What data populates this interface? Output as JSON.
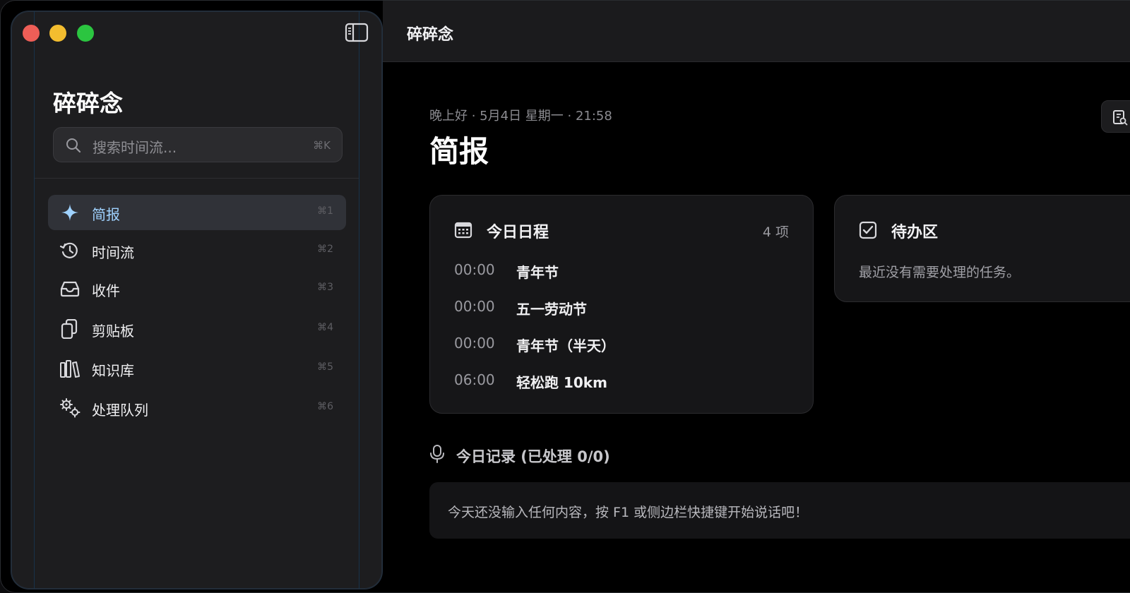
{
  "window": {
    "title": "碎碎念"
  },
  "sidebar": {
    "app_name": "碎碎念",
    "search": {
      "placeholder": "搜索时间流...",
      "shortcut": "⌘K"
    },
    "items": [
      {
        "label": "简报",
        "shortcut": "⌘1",
        "icon": "sparkle-icon",
        "active": true
      },
      {
        "label": "时间流",
        "shortcut": "⌘2",
        "icon": "history-icon",
        "active": false
      },
      {
        "label": "收件",
        "shortcut": "⌘3",
        "icon": "inbox-icon",
        "active": false
      },
      {
        "label": "剪贴板",
        "shortcut": "⌘4",
        "icon": "clipboard-icon",
        "active": false
      },
      {
        "label": "知识库",
        "shortcut": "⌘5",
        "icon": "library-icon",
        "active": false
      },
      {
        "label": "处理队列",
        "shortcut": "⌘6",
        "icon": "gears-icon",
        "active": false
      }
    ]
  },
  "main": {
    "greeting": "晚上好 · 5月4日 星期一 · 21:58",
    "page_title": "简报",
    "schedule": {
      "title": "今日日程",
      "count": "4 项",
      "events": [
        {
          "time": "00:00",
          "name": "青年节"
        },
        {
          "time": "00:00",
          "name": "五一劳动节"
        },
        {
          "time": "00:00",
          "name": "青年节（半天）"
        },
        {
          "time": "06:00",
          "name": "轻松跑 10km"
        }
      ]
    },
    "todo": {
      "title": "待办区",
      "empty_text": "最近没有需要处理的任务。"
    },
    "records": {
      "title": "今日记录 (已处理 0/0)",
      "empty_text": "今天还没输入任何内容，按 F1 或侧边栏快捷键开始说话吧！"
    }
  },
  "colors": {
    "accent": "#9fd2ff",
    "traffic_red": "#ee5e57",
    "traffic_yellow": "#f3bd2f",
    "traffic_green": "#2bc540"
  }
}
